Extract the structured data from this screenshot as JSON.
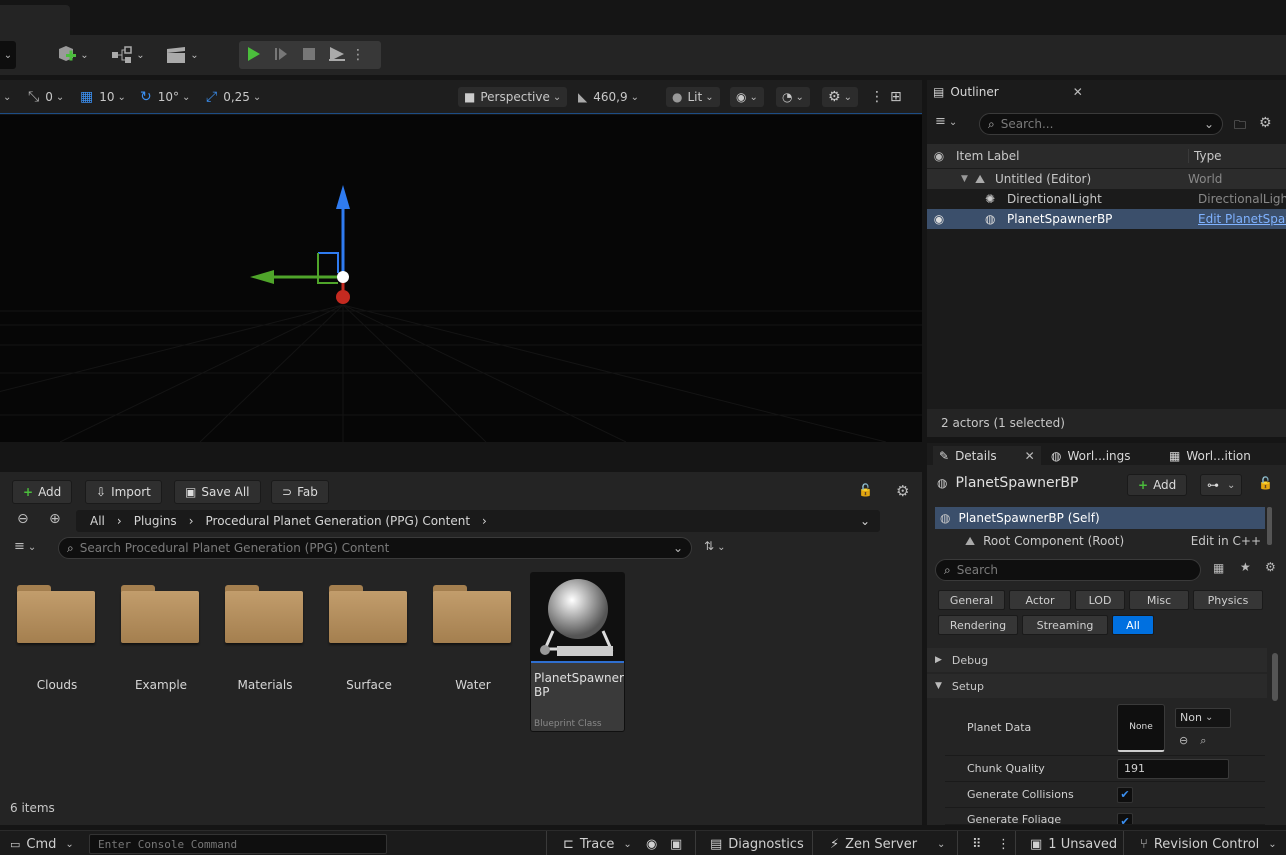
{
  "toolbar": {
    "play_icon": "play-icon",
    "step_icon": "skip-icon",
    "stop_icon": "stop-icon",
    "eject_icon": "eject-icon"
  },
  "viewport": {
    "snap_rotation_small": "0",
    "grid_snap": "10",
    "rotation_snap": "10°",
    "scale_snap": "0,25",
    "view_mode": "Perspective",
    "camera_speed": "460,9",
    "lighting_mode": "Lit"
  },
  "outliner": {
    "title": "Outliner",
    "search_placeholder": "Search...",
    "col_label": "Item Label",
    "col_type": "Type",
    "rows": [
      {
        "label": "Untitled (Editor)",
        "type": "World"
      },
      {
        "label": "DirectionalLight",
        "type": "DirectionalLight"
      },
      {
        "label": "PlanetSpawnerBP",
        "type": "Edit PlanetSpawnerBP"
      }
    ],
    "footer": "2 actors (1 selected)"
  },
  "content_browser": {
    "add_label": "Add",
    "import_label": "Import",
    "save_all_label": "Save All",
    "fab_label": "Fab",
    "breadcrumbs": [
      "All",
      "Plugins",
      "Procedural Planet Generation (PPG) Content"
    ],
    "search_placeholder": "Search Procedural Planet Generation (PPG) Content",
    "folders": [
      "Clouds",
      "Example",
      "Materials",
      "Surface",
      "Water"
    ],
    "asset": {
      "name": "PlanetSpawner BP",
      "type": "Blueprint Class"
    },
    "item_count": "6 items"
  },
  "details": {
    "tabs": [
      "Details",
      "Worl...ings",
      "Worl...ition"
    ],
    "actor_name": "PlanetSpawnerBP",
    "add_label": "Add",
    "self_row": "PlanetSpawnerBP (Self)",
    "root_row": "Root Component (Root)",
    "root_action": "Edit in C++",
    "search_placeholder": "Search",
    "filters": [
      "General",
      "Actor",
      "LOD",
      "Misc",
      "Physics",
      "Rendering",
      "Streaming",
      "All"
    ],
    "active_filter": "All",
    "sections": [
      "Debug",
      "Setup"
    ],
    "planet_data_label": "Planet Data",
    "planet_data_thumb": "None",
    "planet_data_combo": "Non",
    "chunk_quality_label": "Chunk Quality",
    "chunk_quality_value": "191",
    "generate_collisions_label": "Generate Collisions",
    "generate_foliage_label": "Generate Foliage"
  },
  "statusbar": {
    "cmd_label": "Cmd",
    "console_placeholder": "Enter Console Command",
    "trace_label": "Trace",
    "diagnostics_label": "Diagnostics",
    "zen_label": "Zen Server",
    "unsaved_label": "1 Unsaved",
    "revision_label": "Revision Control"
  },
  "colors": {
    "accent_blue": "#0070e0",
    "selection": "#3b4f6b",
    "play_green": "#4bbe3c",
    "folder": "#b8925f"
  }
}
